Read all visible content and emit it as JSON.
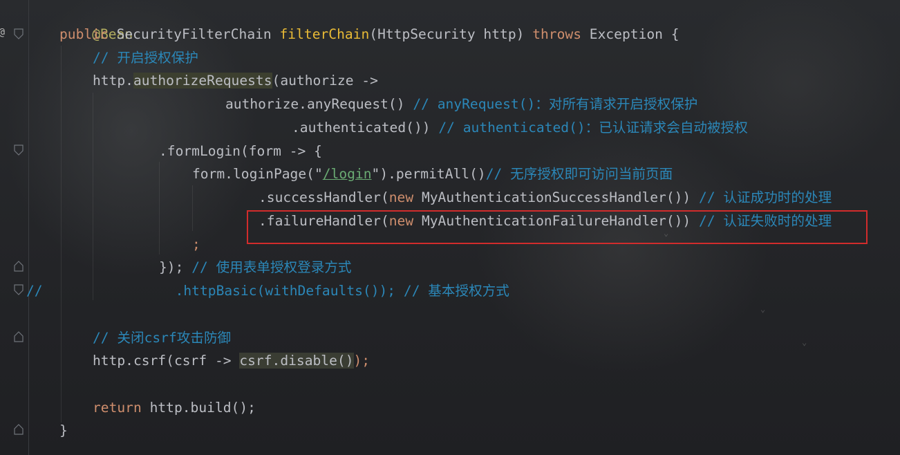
{
  "editor": {
    "lines": [
      {
        "id": "l1",
        "parts": [
          "@Bean"
        ]
      },
      {
        "id": "l2",
        "parts": [
          "public ",
          "SecurityFilterChain ",
          "filterChain",
          "(HttpSecurity http) ",
          "throws ",
          "Exception {"
        ]
      },
      {
        "id": "l3",
        "parts": [
          "// 开启授权保护"
        ]
      },
      {
        "id": "l4",
        "parts": [
          "http.",
          "authorizeRequests",
          "(authorize ->"
        ]
      },
      {
        "id": "l5",
        "parts": [
          "authorize.anyRequest() ",
          "// anyRequest()：对所有请求开启授权保护"
        ]
      },
      {
        "id": "l6",
        "parts": [
          ".authenticated()) ",
          "// authenticated()：已认证请求会自动被授权"
        ]
      },
      {
        "id": "l7",
        "parts": [
          ".formLogin(form -> {"
        ]
      },
      {
        "id": "l8",
        "parts": [
          "form.loginPage(\"",
          "/login",
          "\").permitAll()",
          "// 无序授权即可访问当前页面"
        ]
      },
      {
        "id": "l9",
        "parts": [
          ".successHandler(",
          "new ",
          "MyAuthenticationSuccessHandler()) ",
          "// 认证成功时的处理"
        ]
      },
      {
        "id": "l10",
        "parts": [
          ".failureHandler(",
          "new ",
          "MyAuthenticationFailureHandler()) ",
          "// 认证失败时的处理"
        ]
      },
      {
        "id": "l11",
        "parts": [
          ";"
        ]
      },
      {
        "id": "l12",
        "parts": [
          "}); ",
          "// 使用表单授权登录方式"
        ]
      },
      {
        "id": "l13",
        "parts": [
          "//",
          ".httpBasic(withDefaults()); // 基本授权方式"
        ]
      },
      {
        "id": "l14",
        "parts": [
          "// 关闭csrf攻击防御"
        ]
      },
      {
        "id": "l15",
        "parts": [
          "http.csrf(csrf -> ",
          "csrf.disable()",
          ");"
        ]
      },
      {
        "id": "l16",
        "parts": [
          "return ",
          "http.build();"
        ]
      },
      {
        "id": "l17",
        "parts": [
          "}"
        ]
      }
    ]
  },
  "gutter": {
    "marker": "@",
    "icons": [
      "fold-icon"
    ]
  },
  "colors": {
    "keyword": "#cf8e6d",
    "method_call": "#e8ba36",
    "comment": "#2b87b8",
    "selection_border": "#d22c2c"
  }
}
